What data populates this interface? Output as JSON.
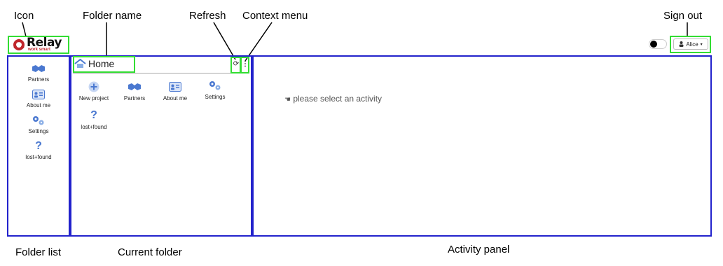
{
  "annotations": {
    "icon": "Icon",
    "folder_name": "Folder name",
    "refresh": "Refresh",
    "context_menu": "Context menu",
    "sign_out": "Sign out",
    "folder_list": "Folder list",
    "current_folder": "Current folder",
    "activity_panel": "Activity panel"
  },
  "logo": {
    "name": "Relay",
    "tagline": "work smart"
  },
  "user": {
    "name": "Alice"
  },
  "folder_list": {
    "items": [
      {
        "label": "Partners",
        "icon": "handshake-icon"
      },
      {
        "label": "About me",
        "icon": "id-card-icon"
      },
      {
        "label": "Settings",
        "icon": "gears-icon"
      },
      {
        "label": "lost+found",
        "icon": "question-icon"
      }
    ]
  },
  "current_folder": {
    "title": "Home",
    "icon": "home-icon",
    "items": [
      {
        "label": "New project",
        "icon": "plus-circle-icon"
      },
      {
        "label": "Partners",
        "icon": "handshake-icon"
      },
      {
        "label": "About me",
        "icon": "id-card-icon"
      },
      {
        "label": "Settings",
        "icon": "gears-icon"
      },
      {
        "label": "lost+found",
        "icon": "question-icon"
      }
    ]
  },
  "activity_panel": {
    "message": "please select an activity"
  },
  "colors": {
    "callout_green": "#33dd33",
    "region_blue": "#2222cc",
    "icon_blue": "#4a78d0",
    "brand_red": "#c0262c"
  }
}
